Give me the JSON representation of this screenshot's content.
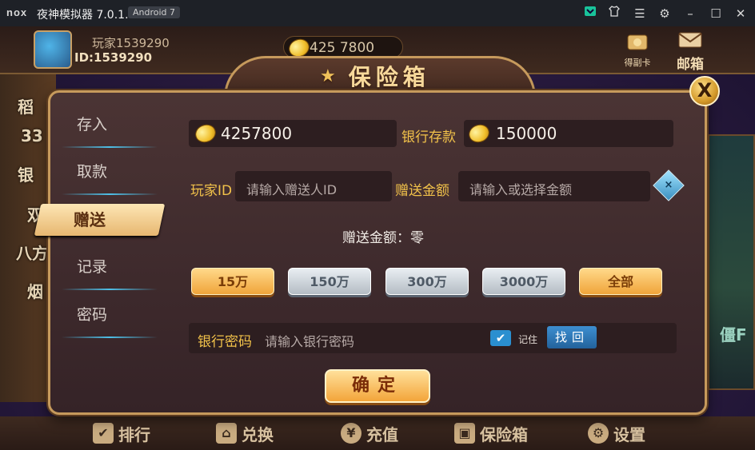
{
  "window": {
    "logo": "nox",
    "title": "夜神模拟器 7.0.1.0",
    "android_badge": "Android 7",
    "controls": [
      "store-icon",
      "shirt-icon",
      "menu-icon",
      "gear-icon",
      "minimize-icon",
      "maximize-icon",
      "close-icon"
    ]
  },
  "topbar": {
    "player_name": "玩家1539290",
    "player_id": "ID:1539290",
    "coins": "425 7800",
    "card_label": "得副卡",
    "mail_label": "邮箱"
  },
  "background": {
    "left_texts": [
      "稻",
      "33",
      "银",
      "双",
      "八方",
      "烟"
    ],
    "right_text": "僵F"
  },
  "dialog": {
    "title": "保险箱",
    "close_label": "X",
    "menu": [
      {
        "label": "存入",
        "active": false
      },
      {
        "label": "取款",
        "active": false
      },
      {
        "label": "赠送",
        "active": true
      },
      {
        "label": "记录",
        "active": false
      },
      {
        "label": "密码",
        "active": false
      }
    ],
    "balance": "4257800",
    "bank_label": "银行存款",
    "bank_balance": "150000",
    "player_id_label": "玩家ID",
    "player_id_placeholder": "请输入赠送人ID",
    "gift_amount_label": "赠送金额",
    "gift_amount_placeholder": "请输入或选择金额",
    "gift_summary_label": "赠送金额：",
    "gift_summary_value": "零",
    "amount_buttons": [
      {
        "label": "15万",
        "style": "gold"
      },
      {
        "label": "150万",
        "style": "silver"
      },
      {
        "label": "300万",
        "style": "silver"
      },
      {
        "label": "3000万",
        "style": "silver"
      },
      {
        "label": "全部",
        "style": "gold"
      }
    ],
    "password_label": "银行密码",
    "password_placeholder": "请输入银行密码",
    "remember_checked": true,
    "remember_label": "记住",
    "recover_label": "找回",
    "confirm_label": "确定"
  },
  "bottombar": [
    {
      "label": "排行",
      "icon": "check-icon"
    },
    {
      "label": "兑换",
      "icon": "shop-icon"
    },
    {
      "label": "充值",
      "icon": "yen-icon"
    },
    {
      "label": "保险箱",
      "icon": "briefcase-icon"
    },
    {
      "label": "设置",
      "icon": "gear-icon"
    }
  ],
  "colors": {
    "accent_gold": "#f2c24a",
    "border_gold": "#c69a5c",
    "panel": "#3f2a2c",
    "blue": "#2a8fd0"
  }
}
